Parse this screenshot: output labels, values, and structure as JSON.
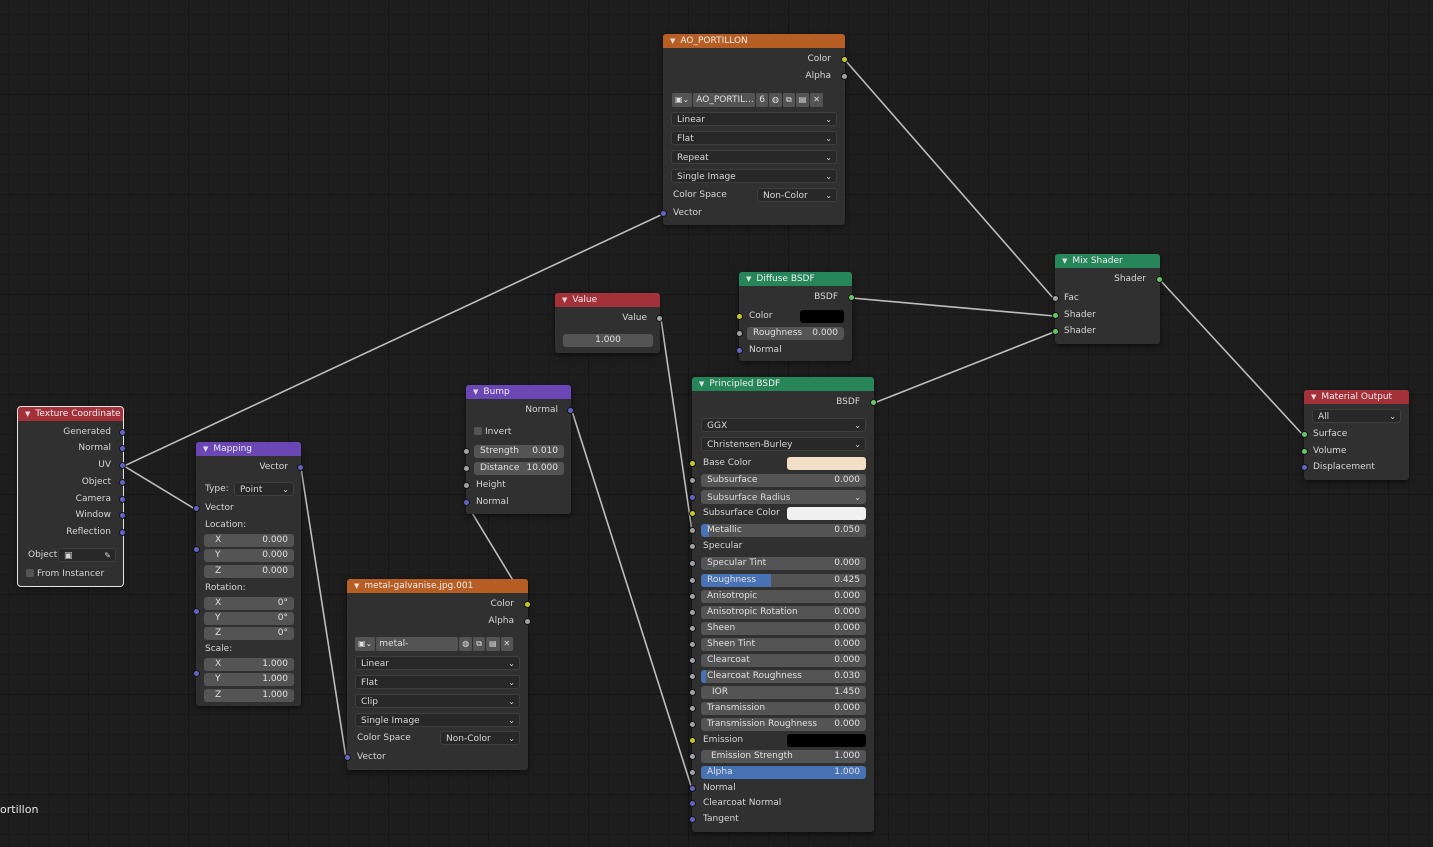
{
  "colors": {
    "texture_header": "#b65e24",
    "shader_header": "#27855a",
    "output_header": "#a33139",
    "vector_header": "#6a47b5",
    "input_header": "#a33139",
    "color_socket": "#c7c729",
    "gray_socket": "#a1a1a1",
    "vector_socket": "#6363c7",
    "shader_socket": "#63c763",
    "slider_fill": "#4772b3"
  },
  "ao": {
    "title": "AO_PORTILLON",
    "out_color": "Color",
    "out_alpha": "Alpha",
    "image_name": "AO_PORTIL...",
    "users": "6",
    "interp": "Linear",
    "proj": "Flat",
    "ext": "Repeat",
    "source": "Single Image",
    "cs_label": "Color Space",
    "cs_value": "Non-Color",
    "in_vector": "Vector"
  },
  "metal": {
    "title": "metal-galvanise.jpg.001",
    "out_color": "Color",
    "out_alpha": "Alpha",
    "image_name": "metal-galvanise.j...",
    "interp": "Linear",
    "proj": "Flat",
    "ext": "Clip",
    "source": "Single Image",
    "cs_label": "Color Space",
    "cs_value": "Non-Color",
    "in_vector": "Vector"
  },
  "texcoord": {
    "title": "Texture Coordinate",
    "outputs": [
      "Generated",
      "Normal",
      "UV",
      "Object",
      "Camera",
      "Window",
      "Reflection"
    ],
    "object_label": "Object:",
    "from_instancer": "From Instancer"
  },
  "mapping": {
    "title": "Mapping",
    "out_vector": "Vector",
    "type_label": "Type:",
    "type_value": "Point",
    "in_vector": "Vector",
    "location_label": "Location:",
    "location": [
      {
        "a": "X",
        "v": "0.000"
      },
      {
        "a": "Y",
        "v": "0.000"
      },
      {
        "a": "Z",
        "v": "0.000"
      }
    ],
    "rotation_label": "Rotation:",
    "rotation": [
      {
        "a": "X",
        "v": "0°"
      },
      {
        "a": "Y",
        "v": "0°"
      },
      {
        "a": "Z",
        "v": "0°"
      }
    ],
    "scale_label": "Scale:",
    "scale": [
      {
        "a": "X",
        "v": "1.000"
      },
      {
        "a": "Y",
        "v": "1.000"
      },
      {
        "a": "Z",
        "v": "1.000"
      }
    ]
  },
  "value": {
    "title": "Value",
    "out": "Value",
    "val": "1.000"
  },
  "bump": {
    "title": "Bump",
    "out": "Normal",
    "invert": "Invert",
    "strength_label": "Strength",
    "strength": "0.010",
    "distance_label": "Distance",
    "distance": "10.000",
    "height": "Height",
    "normal": "Normal"
  },
  "diffuse": {
    "title": "Diffuse BSDF",
    "out": "BSDF",
    "color": "Color",
    "color_value": "#000000",
    "roughness_label": "Roughness",
    "roughness": "0.000",
    "normal": "Normal"
  },
  "principled": {
    "title": "Principled BSDF",
    "out": "BSDF",
    "distribution": "GGX",
    "subsurface_method": "Christensen-Burley",
    "base_color": "Base Color",
    "base_color_value": "#f1dfc6",
    "subsurface": "Subsurface",
    "subsurface_val": "0.000",
    "subsurface_radius": "Subsurface Radius",
    "subsurface_color": "Subsurface Color",
    "subsurface_color_value": "#f0f0f0",
    "metallic": "Metallic",
    "metallic_val": "0.050",
    "metallic_frac": 0.05,
    "specular": "Specular",
    "specular_tint": "Specular Tint",
    "specular_tint_val": "0.000",
    "roughness": "Roughness",
    "roughness_val": "0.425",
    "roughness_frac": 0.425,
    "anisotropic": "Anisotropic",
    "anisotropic_val": "0.000",
    "aniso_rot": "Anisotropic Rotation",
    "aniso_rot_val": "0.000",
    "sheen": "Sheen",
    "sheen_val": "0.000",
    "sheen_tint": "Sheen Tint",
    "sheen_tint_val": "0.000",
    "clearcoat": "Clearcoat",
    "clearcoat_val": "0.000",
    "cc_rough": "Clearcoat Roughness",
    "cc_rough_val": "0.030",
    "cc_rough_frac": 0.03,
    "ior": "IOR",
    "ior_val": "1.450",
    "transmission": "Transmission",
    "transmission_val": "0.000",
    "trans_rough": "Transmission Roughness",
    "trans_rough_val": "0.000",
    "emission": "Emission",
    "emission_value": "#000000",
    "emission_strength": "Emission Strength",
    "emission_strength_val": "1.000",
    "alpha": "Alpha",
    "alpha_val": "1.000",
    "alpha_frac": 1.0,
    "normal": "Normal",
    "clearcoat_normal": "Clearcoat Normal",
    "tangent": "Tangent"
  },
  "mix": {
    "title": "Mix Shader",
    "out": "Shader",
    "fac": "Fac",
    "shader1": "Shader",
    "shader2": "Shader"
  },
  "output": {
    "title": "Material Output",
    "target": "All",
    "surface": "Surface",
    "volume": "Volume",
    "displacement": "Displacement"
  },
  "corner_text": "ortillon"
}
